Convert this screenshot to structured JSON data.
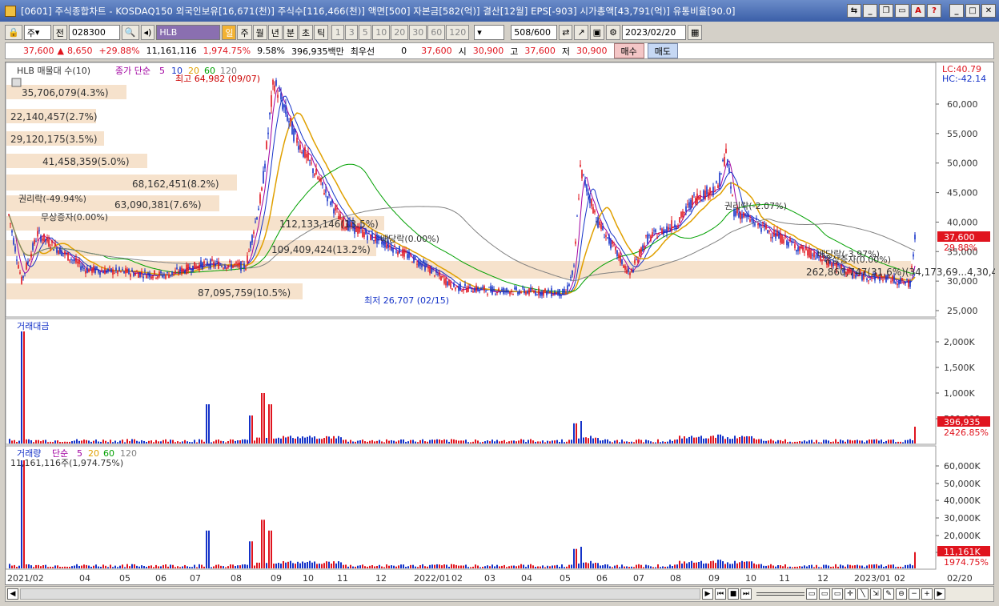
{
  "window": {
    "title": "[0601] 주식종합차트 - KOSDAQ150 외국인보유[16,671(천)] 주식수[116,466(천)] 액면[500] 자본금[582(억)] 결산[12월] EPS[-903] 시가총액[43,791(억)] 유통비율[90.0]"
  },
  "toolbar": {
    "market_select": "주",
    "prev_label": "전",
    "code": "028300",
    "stock_name": "HLB",
    "periods": [
      "일",
      "주",
      "월",
      "년",
      "분",
      "초",
      "틱"
    ],
    "intervals": [
      "1",
      "3",
      "5",
      "10",
      "20",
      "30",
      "60",
      "120"
    ],
    "count": "508",
    "count_total": "/600",
    "date": "2023/02/20"
  },
  "quote": {
    "price": "37,600",
    "change": "8,650",
    "change_pct": "+29.88%",
    "volume": "11,161,116",
    "volume_pct": "1,974.75%",
    "turnover": "9.58%",
    "amount": "396,935백만",
    "best_label": "최우선",
    "best_value": "0",
    "ask": "37,600",
    "open_label": "시",
    "open": "30,900",
    "high_label": "고",
    "high": "37,600",
    "low_label": "저",
    "low": "30,900",
    "buy_label": "매수",
    "sell_label": "매도"
  },
  "price_panel": {
    "legend_name": "HLB 매물대 수(10)",
    "ma_label": "종가 단순",
    "ma_periods": [
      "5",
      "10",
      "20",
      "60",
      "120"
    ],
    "lc": "LC:40.79",
    "hc": "HC:-42.14",
    "high_marker": "최고 64,982 (09/07)",
    "low_marker": "최저 26,707 (02/15)",
    "events": [
      "권리락(-49.94%)",
      "무상증자(0.00%)",
      "배당락(0.00%)",
      "권리락(-2.07%)",
      "배당락(-3.97%)",
      "유상증자(0.00%)"
    ],
    "profile_labels": [
      "35,706,079(4.3%)",
      "22,140,457(2.7%)",
      "29,120,175(3.5%)",
      "41,458,359(5.0%)",
      "68,162,451(8.2%)",
      "63,090,381(7.6%)",
      "112,133,146(13.5%)",
      "109,409,424(13.2%)",
      "262,860,747(31.6%)(34,173,69...4,30,407,403)",
      "87,095,759(10.5%)"
    ],
    "y_ticks": [
      "60,000",
      "55,000",
      "50,000",
      "45,000",
      "40,000",
      "35,000",
      "30,000",
      "25,000"
    ],
    "price_tag": "37,600",
    "pct_tag": "29.88%"
  },
  "amount_panel": {
    "title": "거래대금",
    "y_ticks": [
      "2,000K",
      "1,500K",
      "1,000K",
      "500,000"
    ],
    "value_tag": "396,935",
    "pct_tag": "2426.85%"
  },
  "volume_panel": {
    "title": "거래량",
    "ma_label": "단순",
    "ma_periods": [
      "5",
      "20",
      "60",
      "120"
    ],
    "current": "11,161,116주(1,974.75%)",
    "y_ticks": [
      "60,000K",
      "50,000K",
      "40,000K",
      "30,000K",
      "20,000K",
      "10,000K"
    ],
    "value_tag": "11,161K",
    "pct_tag": "1974.75%"
  },
  "x_axis": [
    "2021/02",
    "04",
    "05",
    "06",
    "07",
    "08",
    "09",
    "10",
    "11",
    "12",
    "2022/01",
    "02",
    "03",
    "04",
    "05",
    "06",
    "07",
    "08",
    "09",
    "10",
    "11",
    "12",
    "2023/01",
    "02"
  ],
  "x_axis_end": "02/20",
  "colors": {
    "up": "#e0141e",
    "down": "#1432c8",
    "ma5": "#a000a0",
    "ma10": "#1432c8",
    "ma20": "#e0a000",
    "ma60": "#00a000",
    "ma120": "#808080",
    "profile": "#f6e2cc"
  }
}
